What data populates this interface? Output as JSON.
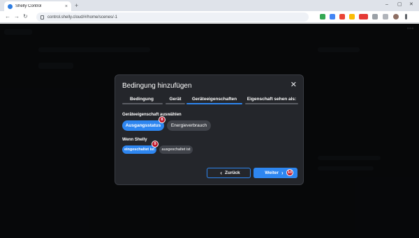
{
  "browser": {
    "tab_title": "Shelly Control",
    "tab_close": "×",
    "new_tab": "+",
    "url": "control.shelly.cloud/#/home/scenes/-1",
    "back": "←",
    "forward": "→",
    "reload": "↻",
    "minimize": "–",
    "maximize": "▢",
    "close": "✕"
  },
  "app": {
    "version": "0.9.0"
  },
  "modal": {
    "title": "Bedingung hinzufügen",
    "close": "✕",
    "steps": [
      {
        "label": "Bedingung",
        "active": false
      },
      {
        "label": "Gerät",
        "active": false
      },
      {
        "label": "Geräteeigenschaften",
        "active": true
      },
      {
        "label": "Eigenschaft sehen als:",
        "active": false
      }
    ],
    "property_section": {
      "label": "Geräteeigenschaft auswählen",
      "options": [
        {
          "label": "Ausgangsstatus",
          "selected": true
        },
        {
          "label": "Energieverbrauch",
          "selected": false
        }
      ],
      "badge": "8"
    },
    "condition_section": {
      "label": "Wenn Shelly",
      "options": [
        {
          "label": "eingeschaltet ist",
          "selected": true
        },
        {
          "label": "ausgeschaltet ist",
          "selected": false
        }
      ],
      "badge": "9"
    },
    "back_button": "Zurück",
    "next_button": "Weiter",
    "next_badge": "10",
    "back_chevron": "‹",
    "next_chevron": "›"
  },
  "colors": {
    "accent": "#2e86f0",
    "badge": "#c0182c",
    "modal_bg": "#24262b"
  }
}
